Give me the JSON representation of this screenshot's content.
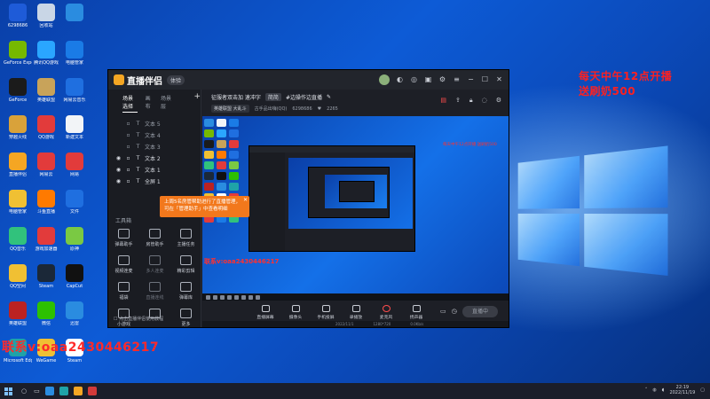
{
  "desktop": {
    "icons": [
      {
        "label": "6298686",
        "color": "#1e5bd8"
      },
      {
        "label": "回收站",
        "color": "#c9d6e6"
      },
      {
        "label": "",
        "color": "#2a8ce0"
      },
      {
        "label": "GeForce Experience",
        "color": "#76b900"
      },
      {
        "label": "腾讯QQ游戏",
        "color": "#2aa6ff"
      },
      {
        "label": "电脑管家",
        "color": "#1a7be6"
      },
      {
        "label": "GeForce",
        "color": "#1b1b1b"
      },
      {
        "label": "英雄联盟",
        "color": "#c8a35a"
      },
      {
        "label": "网易云音乐",
        "color": "#1f6fe0"
      },
      {
        "label": "穿越火线",
        "color": "#d9a23a"
      },
      {
        "label": "QQ游戏",
        "color": "#e23b3b"
      },
      {
        "label": "新建文本",
        "color": "#f2f4f7"
      },
      {
        "label": "直播伴侣",
        "color": "#f5a623"
      },
      {
        "label": "网易云",
        "color": "#e23b3b"
      },
      {
        "label": "网易",
        "color": "#e23b3b"
      },
      {
        "label": "电脑管家",
        "color": "#f0c033"
      },
      {
        "label": "斗鱼直播",
        "color": "#ff7a00"
      },
      {
        "label": "文件",
        "color": "#1f6fe0"
      },
      {
        "label": "QQ音乐",
        "color": "#31c27c"
      },
      {
        "label": "游戏加速器",
        "color": "#e23b3b"
      },
      {
        "label": "原神",
        "color": "#7ac943"
      },
      {
        "label": "QQ空间",
        "color": "#f0c033"
      },
      {
        "label": "Steam",
        "color": "#1b2838"
      },
      {
        "label": "CapCut",
        "color": "#111111"
      },
      {
        "label": "英雄联盟",
        "color": "#b22"
      },
      {
        "label": "微信",
        "color": "#2dc100"
      },
      {
        "label": "迅雷",
        "color": "#2a8ce0"
      },
      {
        "label": "Microsoft Edge",
        "color": "#1fa3a8"
      },
      {
        "label": "WeGame",
        "color": "#f0c033"
      },
      {
        "label": "Steam",
        "color": "#ffffff"
      }
    ],
    "promo_line1": "每天中午12点开播",
    "promo_line2": "送刷奶500",
    "contact": "联系v:oaa2430446217"
  },
  "app": {
    "name": "直播伴侣",
    "version": "体验",
    "tabs": [
      "场景选择",
      "画布",
      "场景层"
    ],
    "layers": [
      {
        "name": "文本 5",
        "visible": false
      },
      {
        "name": "文本 4",
        "visible": false
      },
      {
        "name": "文本 3",
        "visible": false
      },
      {
        "name": "文本 2",
        "visible": true
      },
      {
        "name": "文本 1",
        "visible": true
      },
      {
        "name": "全屏 1",
        "visible": true
      }
    ],
    "tools_title": "工具箱",
    "tools": [
      {
        "label": "弹幕助手",
        "dim": false
      },
      {
        "label": "房管助手",
        "dim": false
      },
      {
        "label": "主播任务",
        "dim": false
      },
      {
        "label": "视频连麦",
        "dim": false
      },
      {
        "label": "多人连麦",
        "dim": true
      },
      {
        "label": "精彩剪辑",
        "dim": false
      },
      {
        "label": "福袋",
        "dim": false
      },
      {
        "label": "直播连线",
        "dim": true
      },
      {
        "label": "弹幕库",
        "dim": false
      },
      {
        "label": "小游戏",
        "dim": false
      },
      {
        "label": "",
        "dim": false
      },
      {
        "label": "更多",
        "dim": false
      }
    ],
    "footer": "☐ 点击直播伴侣使用教程",
    "tip": {
      "text": "上周5名房管帮助进行了直播管理，可在「管理助手」中查看明细",
      "close": "✕"
    },
    "room": {
      "title": "征服者双击加 速冲字",
      "tag1": "简简",
      "tag2": "#边操作边直播",
      "meta_chip": "英雄联盟  大乱斗",
      "meta_text": "古手品出嗨(QQ)",
      "viewers": "6298686",
      "likes": "2265"
    },
    "stage": {
      "red_note": "每天中午12点开播 送刷奶500",
      "contact": "联系v:oaa2430446217"
    },
    "controls": [
      {
        "label": "直播屏幕",
        "mic": false
      },
      {
        "label": "摄像头",
        "mic": false
      },
      {
        "label": "手机投屏",
        "mic": false
      },
      {
        "label": "录播放",
        "mic": false
      },
      {
        "label": "麦克风",
        "mic": true
      },
      {
        "label": "扬声器",
        "mic": false
      }
    ],
    "go_live": "直播中",
    "status": {
      "left": "2022/11/1",
      "mid": "1280*720",
      "right": "0.0Kb/s"
    }
  },
  "taskbar": {
    "time": "22:19",
    "date": "2022/11/19",
    "apps": [
      "#2a8ce0",
      "#1fa3a8",
      "#f5a623",
      "#d23a3a"
    ]
  }
}
